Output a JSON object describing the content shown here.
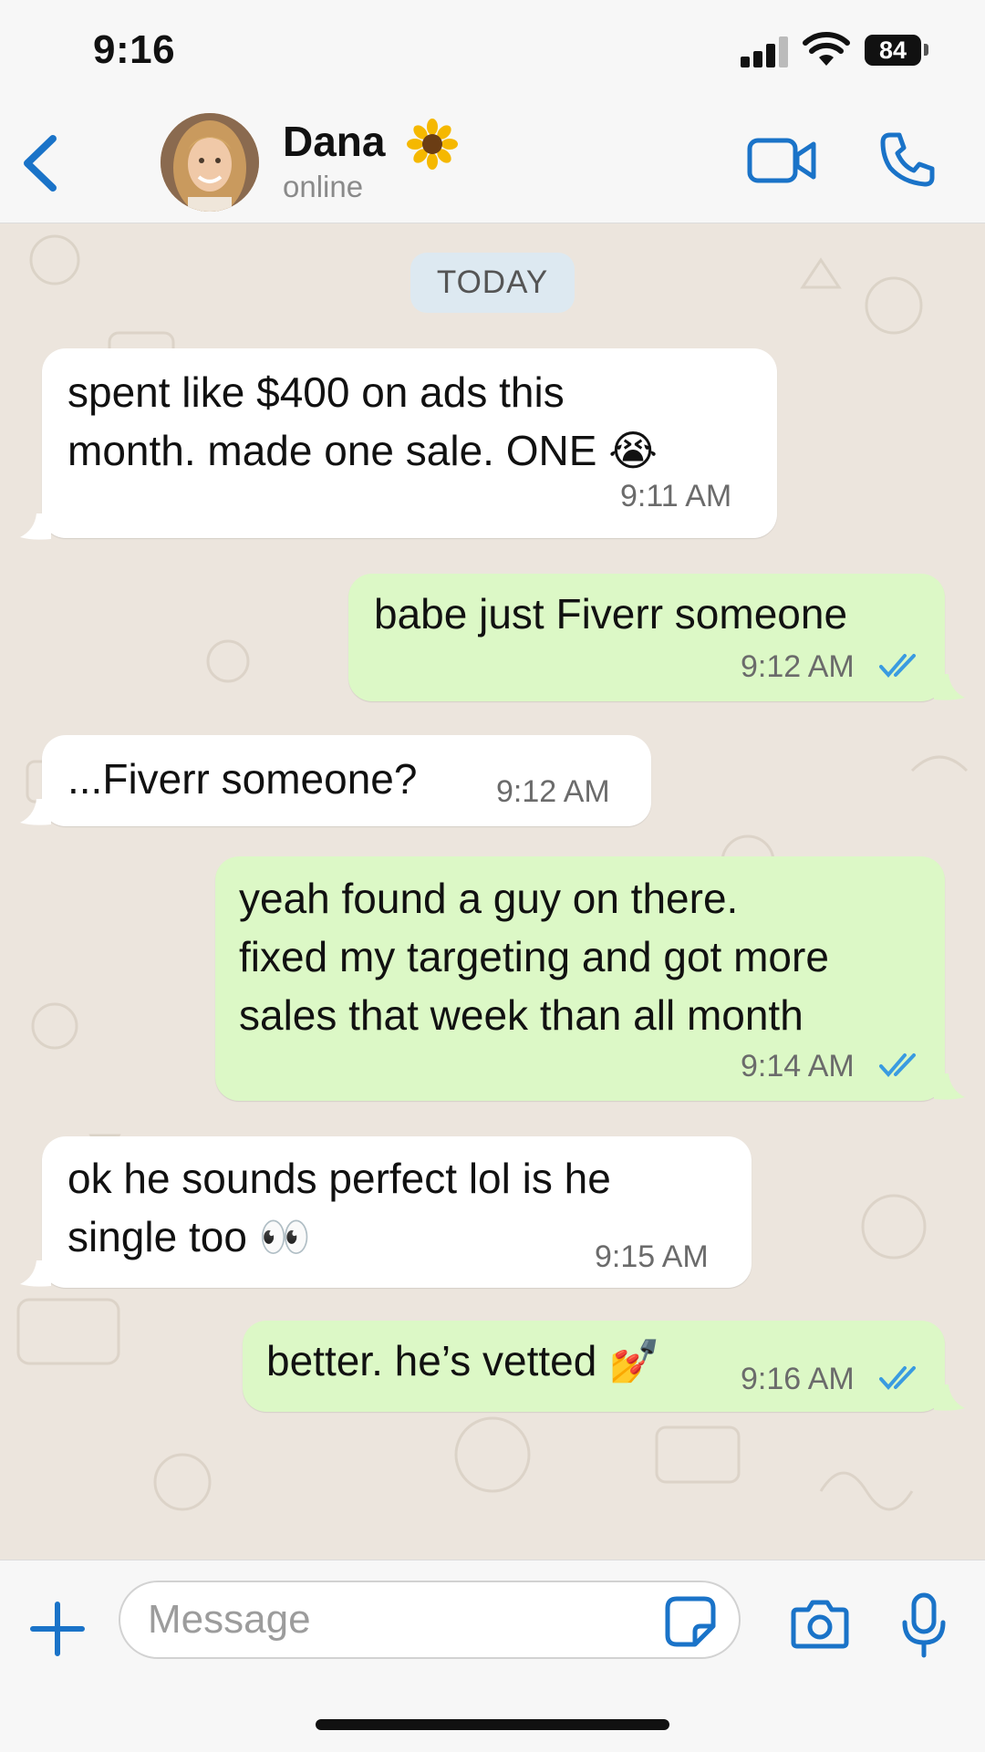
{
  "status_bar": {
    "time": "9:16",
    "battery": "84"
  },
  "header": {
    "contact_name": "Dana",
    "contact_status": "online"
  },
  "chat": {
    "date_label": "TODAY",
    "messages": [
      {
        "direction": "incoming",
        "text": "spent like $400 on ads this\nmonth. made one sale. ONE 😭",
        "time": "9:11 AM"
      },
      {
        "direction": "outgoing",
        "text": "babe just Fiverr someone",
        "time": "9:12 AM",
        "read": true
      },
      {
        "direction": "incoming",
        "text": "...Fiverr someone?",
        "time": "9:12 AM"
      },
      {
        "direction": "outgoing",
        "text": "yeah found a guy on there.\nfixed my targeting and got more\nsales that week than all month",
        "time": "9:14 AM",
        "read": true
      },
      {
        "direction": "incoming",
        "text": "ok he sounds perfect lol is he\nsingle too 👀",
        "time": "9:15 AM"
      },
      {
        "direction": "outgoing",
        "text": "better. he’s vetted 💅",
        "time": "9:16 AM",
        "read": true
      }
    ]
  },
  "input_bar": {
    "placeholder": "Message"
  },
  "colors": {
    "accent": "#1a73c8",
    "outgoing_bubble": "#dcf8c6",
    "incoming_bubble": "#ffffff",
    "chat_bg": "#ece5dd",
    "read_ticks": "#3a9be0"
  },
  "icons": [
    "back-chevron-icon",
    "sunflower-icon",
    "video-camera-icon",
    "phone-icon",
    "plus-icon",
    "sticker-icon",
    "camera-icon",
    "microphone-icon",
    "read-receipt-icon"
  ]
}
